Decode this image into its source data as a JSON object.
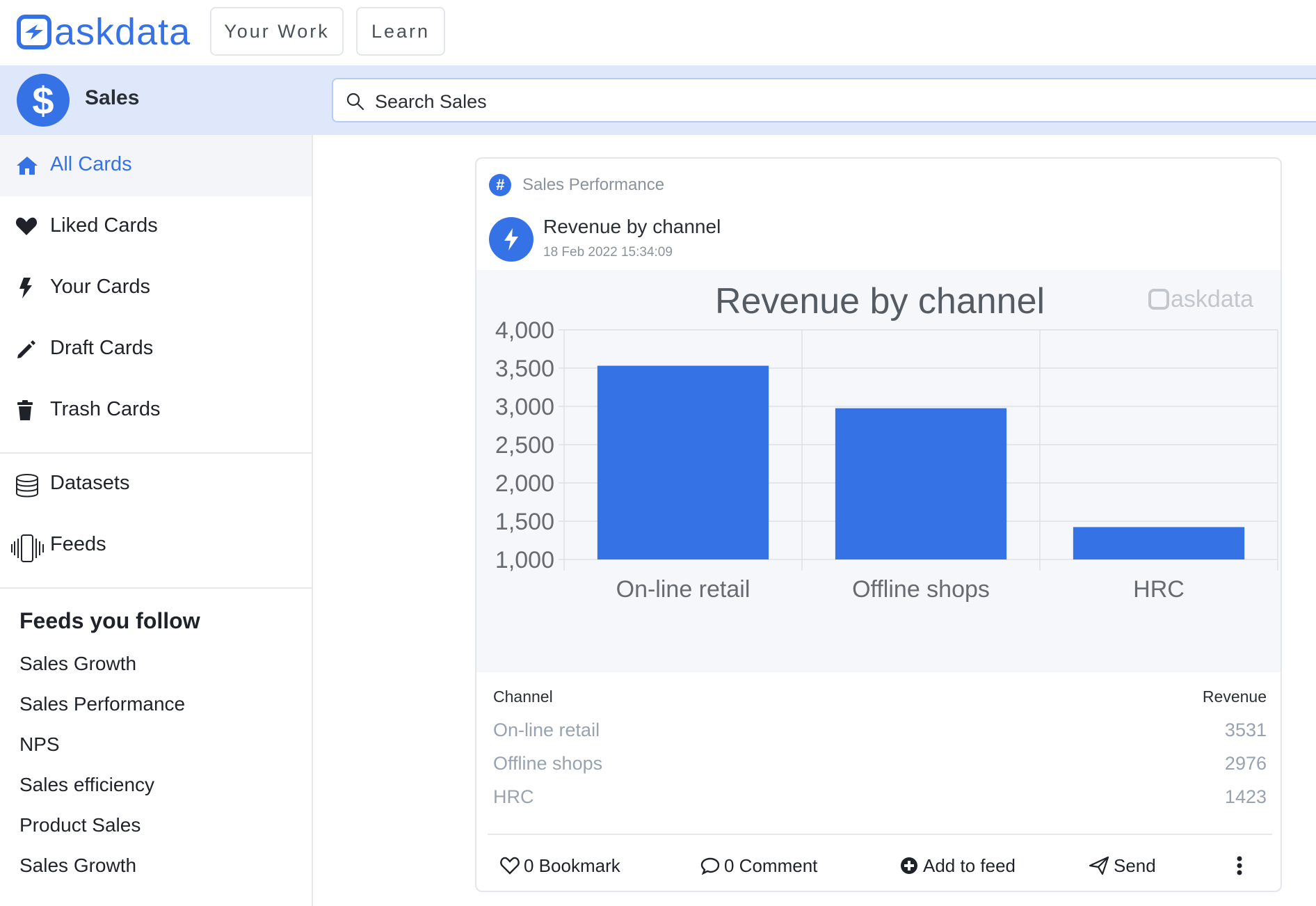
{
  "app": {
    "brand": "askdata",
    "accent": "#3572e6"
  },
  "topnav": {
    "your_work": "Your Work",
    "learn": "Learn"
  },
  "workspace": {
    "icon": "$",
    "name": "Sales"
  },
  "search": {
    "placeholder": "Search Sales"
  },
  "sidebar": {
    "items": [
      {
        "label": "All Cards",
        "icon": "home-icon",
        "active": true
      },
      {
        "label": "Liked Cards",
        "icon": "heart-icon"
      },
      {
        "label": "Your Cards",
        "icon": "bolt-icon"
      },
      {
        "label": "Draft Cards",
        "icon": "pencil-icon"
      },
      {
        "label": "Trash Cards",
        "icon": "trash-icon"
      },
      {
        "label": "Datasets",
        "icon": "database-icon"
      },
      {
        "label": "Feeds",
        "icon": "feeds-icon"
      }
    ],
    "feeds_title": "Feeds you follow",
    "feeds": [
      "Sales Growth",
      "Sales Performance",
      "NPS",
      "Sales efficiency",
      "Product Sales",
      "Sales Growth"
    ]
  },
  "card": {
    "feed_tag": "Sales Performance",
    "title": "Revenue by channel",
    "timestamp": "18 Feb 2022 15:34:09",
    "watermark": "askdata",
    "table": {
      "headers": [
        "Channel",
        "Revenue"
      ],
      "rows": [
        [
          "On-line retail",
          "3531"
        ],
        [
          "Offline shops",
          "2976"
        ],
        [
          "HRC",
          "1423"
        ]
      ]
    },
    "actions": {
      "bookmark": "0 Bookmark",
      "comment": "0 Comment",
      "add_to_feed": "Add to feed",
      "send": "Send"
    }
  },
  "chart_data": {
    "type": "bar",
    "title": "Revenue by channel",
    "categories": [
      "On-line retail",
      "Offline shops",
      "HRC"
    ],
    "values": [
      3531,
      2976,
      1423
    ],
    "ylim": [
      1000,
      4000
    ],
    "yticks": [
      "4,000",
      "3,500",
      "3,000",
      "2,500",
      "2,000",
      "1,500",
      "1,000"
    ],
    "bar_color": "#3572e6",
    "grid": true
  }
}
